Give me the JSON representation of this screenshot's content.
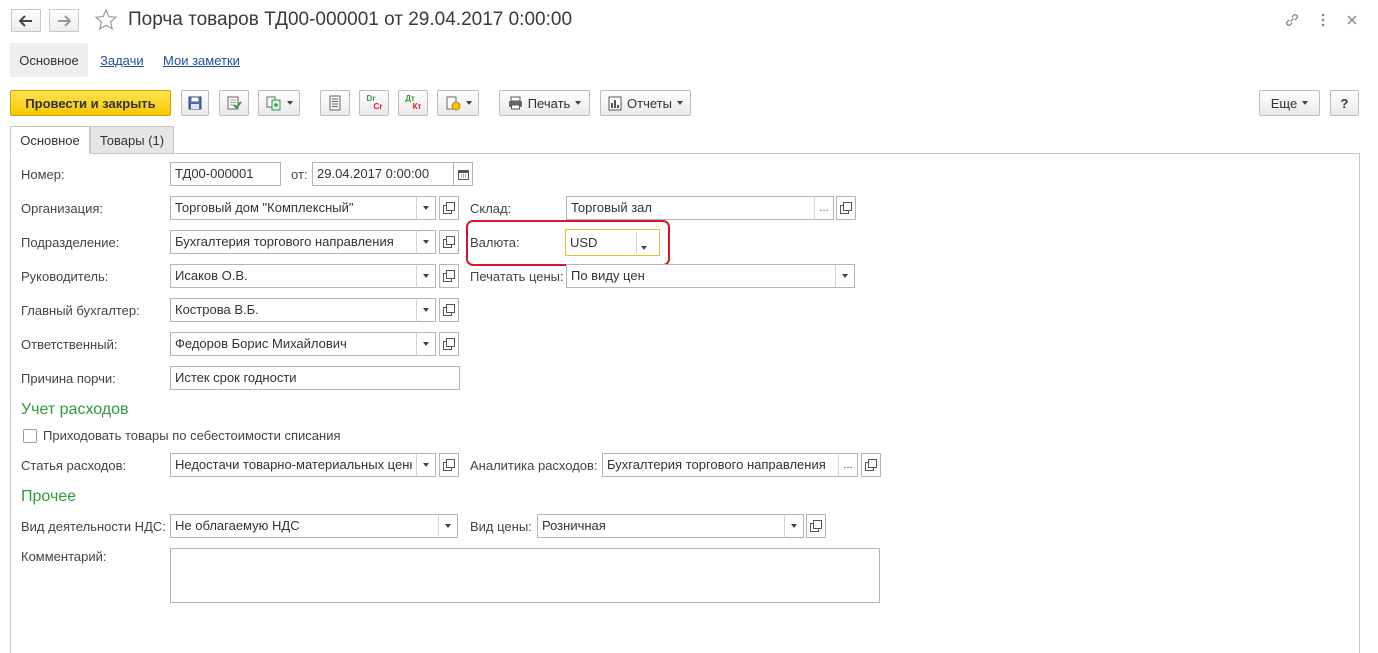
{
  "window": {
    "title": "Порча товаров ТД00-000001 от 29.04.2017 0:00:00"
  },
  "section_tabs": {
    "main": "Основное",
    "tasks": "Задачи",
    "notes": "Мои заметки"
  },
  "toolbar": {
    "post_close": "Провести и закрыть",
    "print": "Печать",
    "reports": "Отчеты",
    "more": "Еще",
    "help": "?",
    "dr_cr_top": "Dr",
    "dr_cr_bottom": "Cr",
    "dt_kt_top": "Дт",
    "dt_kt_bottom": "Кт"
  },
  "form_tabs": {
    "main": "Основное",
    "goods": "Товары (1)"
  },
  "fields": {
    "number": {
      "label": "Номер:",
      "value": "ТД00-000001"
    },
    "date": {
      "label": "от:",
      "value": "29.04.2017  0:00:00"
    },
    "organization": {
      "label": "Организация:",
      "value": "Торговый дом \"Комплексный\""
    },
    "warehouse": {
      "label": "Склад:",
      "value": "Торговый зал"
    },
    "department": {
      "label": "Подразделение:",
      "value": "Бухгалтерия торгового направления"
    },
    "currency": {
      "label": "Валюта:",
      "value": "USD"
    },
    "manager": {
      "label": "Руководитель:",
      "value": "Исаков О.В."
    },
    "print_prices": {
      "label": "Печатать цены:",
      "value": "По виду цен"
    },
    "chief_accountant": {
      "label": "Главный бухгалтер:",
      "value": "Кострова В.Б."
    },
    "responsible": {
      "label": "Ответственный:",
      "value": "Федоров Борис Михайлович"
    },
    "damage_reason": {
      "label": "Причина порчи:",
      "value": "Истек срок годности"
    }
  },
  "expenses": {
    "title": "Учет расходов",
    "checkbox_label": "Приходовать товары по себестоимости списания",
    "checkbox_checked": false,
    "expense_item": {
      "label": "Статья расходов:",
      "value": "Недостачи товарно-материальных ценностей"
    },
    "expense_analytics": {
      "label": "Аналитика расходов:",
      "value": "Бухгалтерия торгового направления"
    }
  },
  "other": {
    "title": "Прочее",
    "vat_activity": {
      "label": "Вид деятельности НДС:",
      "value": "Не облагаемую НДС"
    },
    "price_type": {
      "label": "Вид цены:",
      "value": "Розничная"
    },
    "comment": {
      "label": "Комментарий:",
      "value": ""
    }
  },
  "colors": {
    "accent_green": "#2e9b3a",
    "primary_button": "#f6c800",
    "highlight_red": "#d8182a",
    "link_blue": "#1f4fa6"
  },
  "icons": [
    "back-arrow-icon",
    "forward-arrow-icon",
    "star-icon",
    "link-icon",
    "more-vertical-icon",
    "close-icon",
    "save-icon",
    "post-icon",
    "create-based-on-icon",
    "list-icon",
    "printer-icon",
    "reports-icon",
    "chevron-down-icon",
    "open-icon",
    "calendar-icon"
  ]
}
